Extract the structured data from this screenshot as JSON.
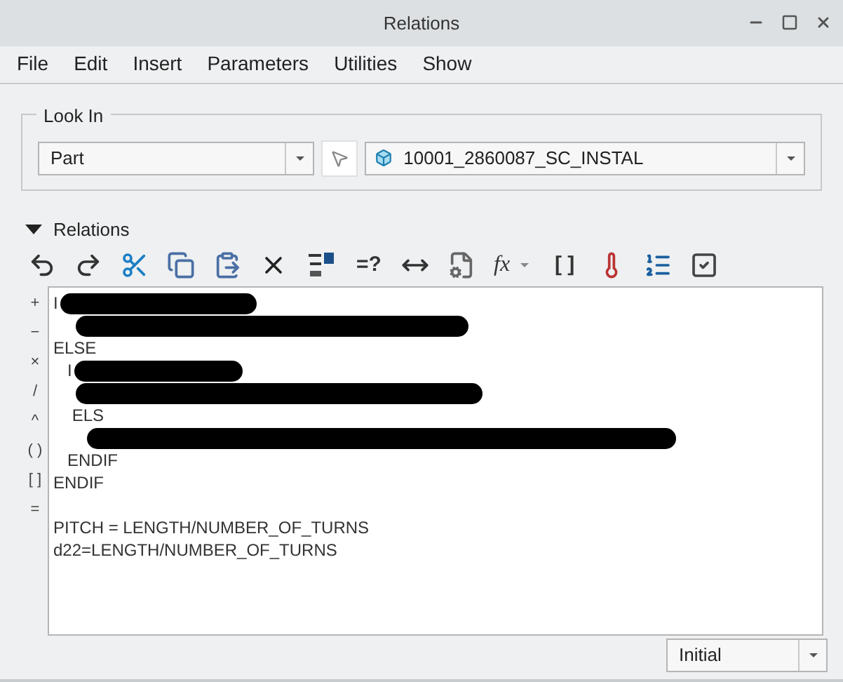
{
  "window": {
    "title": "Relations"
  },
  "menu": [
    "File",
    "Edit",
    "Insert",
    "Parameters",
    "Utilities",
    "Show"
  ],
  "look_in": {
    "title": "Look In",
    "type_value": "Part",
    "model_value": "10001_2860087_SC_INSTAL"
  },
  "relations": {
    "title": "Relations",
    "expanded": true,
    "toolbar": [
      {
        "kind": "undo"
      },
      {
        "kind": "redo"
      },
      {
        "kind": "cut"
      },
      {
        "kind": "copy"
      },
      {
        "kind": "paste"
      },
      {
        "kind": "delete"
      },
      {
        "kind": "symbols"
      },
      {
        "kind": "text",
        "label": "=?"
      },
      {
        "kind": "measure"
      },
      {
        "kind": "params"
      },
      {
        "kind": "function",
        "label": "fx"
      },
      {
        "kind": "text",
        "label": "[ ]"
      },
      {
        "kind": "units"
      },
      {
        "kind": "sort"
      },
      {
        "kind": "verify"
      }
    ],
    "operators": [
      "+",
      "−",
      "×",
      "/",
      "^",
      "( )",
      "[ ]",
      "="
    ],
    "lines": [
      {
        "kind": "code",
        "text": "I",
        "redacted": true
      },
      {
        "kind": "redacted"
      },
      {
        "kind": "code",
        "text": "ELSE",
        "redacted": false
      },
      {
        "kind": "code",
        "text": "   I",
        "redacted": true
      },
      {
        "kind": "redacted"
      },
      {
        "kind": "code",
        "text": "    ELS",
        "redacted": false
      },
      {
        "kind": "redacted"
      },
      {
        "kind": "code",
        "text": "   ENDIF",
        "redacted": false
      },
      {
        "kind": "code",
        "text": "ENDIF",
        "redacted": false
      },
      {
        "kind": "blank"
      },
      {
        "kind": "code",
        "text": "PITCH = LENGTH/NUMBER_OF_TURNS",
        "redacted": false
      },
      {
        "kind": "code",
        "text": "d22=LENGTH/NUMBER_OF_TURNS",
        "redacted": false
      }
    ]
  },
  "units_value": "Initial"
}
